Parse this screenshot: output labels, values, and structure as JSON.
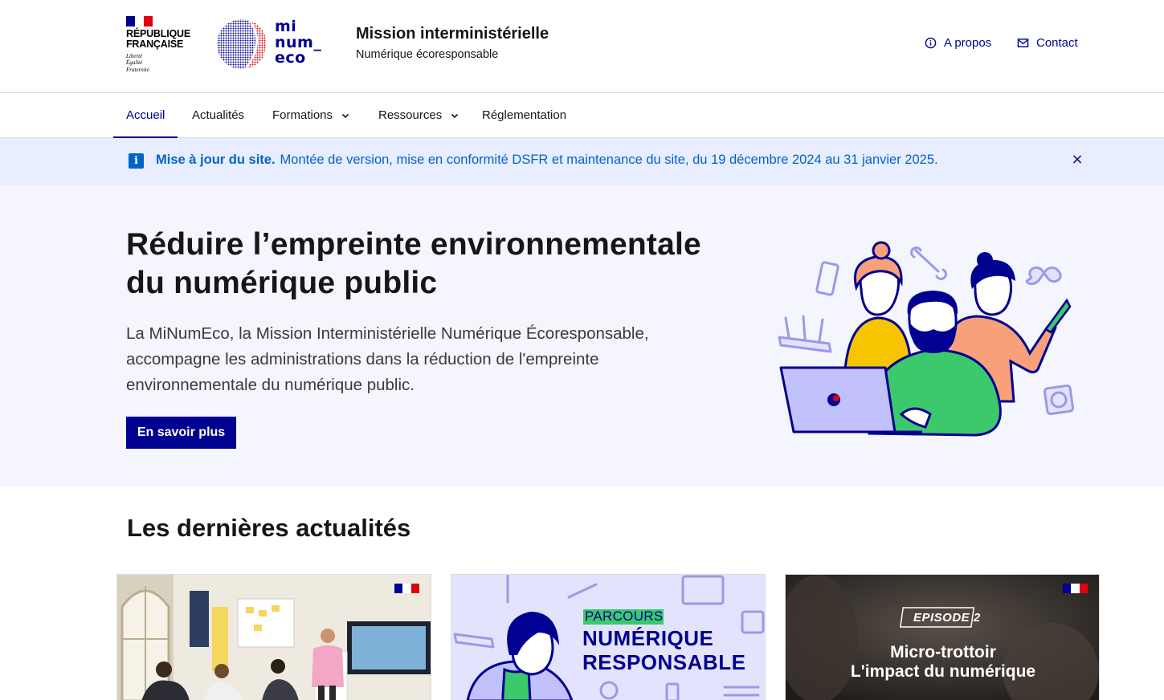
{
  "brand": {
    "republic_lines": [
      "RÉPUBLIQUE",
      "FRANÇAISE"
    ],
    "motto_lines": [
      "Liberté",
      "Égalité",
      "Fraternité"
    ],
    "logo_text_lines": [
      "mi",
      "num_",
      "eco"
    ],
    "service_title": "Mission interministérielle",
    "service_tagline": "Numérique écoresponsable"
  },
  "tools": {
    "about_label": "A propos",
    "contact_label": "Contact"
  },
  "nav": {
    "items": [
      {
        "label": "Accueil",
        "active": true
      },
      {
        "label": "Actualités"
      },
      {
        "label": "Formations",
        "dropdown": true
      },
      {
        "label": "Ressources",
        "dropdown": true
      },
      {
        "label": "Réglementation"
      }
    ]
  },
  "notice": {
    "title": "Mise à jour du site.",
    "text": "Montée de version, mise en conformité DSFR et maintenance du site, du 19 décembre 2024 au 31 janvier 2025.",
    "icon": "info-icon",
    "close_icon": "close-icon"
  },
  "hero": {
    "title_lines": [
      "Réduire l’empreinte environnementale",
      "du numérique public"
    ],
    "lead_lines": [
      "La MiNumEco, la Mission Interministérielle Numérique Écoresponsable,",
      "accompagne les administrations dans la réduction de l'empreinte",
      "environnementale du numérique public."
    ],
    "button_label": "En savoir plus"
  },
  "news": {
    "title": "Les dernières actualités",
    "cards": [
      {
        "image": "training-room-photo"
      },
      {
        "image": "parcours-illustration",
        "tag": "PARCOURS",
        "headline_lines": [
          "NUMÉRIQUE",
          "RESPONSABLE"
        ]
      },
      {
        "image": "video-thumbnail",
        "episode": "EPISODE 2",
        "headline_lines": [
          "Micro-trottoir",
          "L'impact du numérique"
        ]
      }
    ]
  },
  "colors": {
    "primary": "#000091",
    "info": "#0063cb",
    "notice_bg": "#e8edff",
    "hero_bg": "#f5f5fe",
    "flag_blue": "#000091",
    "flag_red": "#e1000f",
    "green": "#3cc96b",
    "orange": "#f7a07a",
    "yellow": "#f7c500"
  }
}
